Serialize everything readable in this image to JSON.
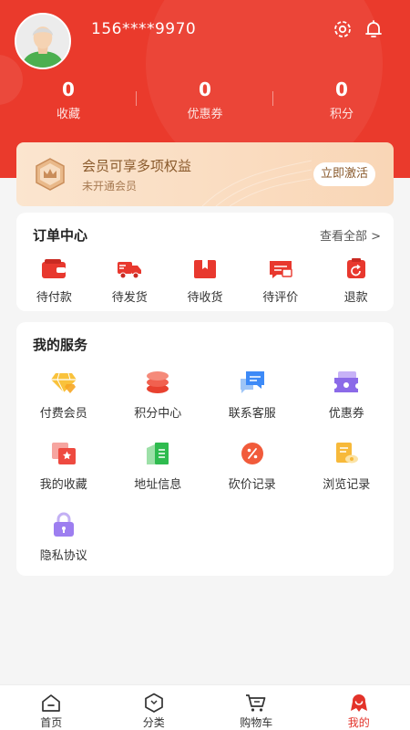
{
  "profile": {
    "phone": "156****9970"
  },
  "header_icons": {
    "settings": "gear-icon",
    "notifications": "bell-icon"
  },
  "stats": [
    {
      "value": "0",
      "label": "收藏"
    },
    {
      "value": "0",
      "label": "优惠券"
    },
    {
      "value": "0",
      "label": "积分"
    }
  ],
  "vip": {
    "title": "会员可享多项权益",
    "subtitle": "未开通会员",
    "action": "立即激活"
  },
  "orders": {
    "title": "订单中心",
    "more": "查看全部 >",
    "items": [
      {
        "label": "待付款",
        "icon": "wallet-icon"
      },
      {
        "label": "待发货",
        "icon": "truck-icon"
      },
      {
        "label": "待收货",
        "icon": "package-icon"
      },
      {
        "label": "待评价",
        "icon": "comment-icon"
      },
      {
        "label": "退款",
        "icon": "refund-icon"
      }
    ]
  },
  "services": {
    "title": "我的服务",
    "items": [
      {
        "label": "付费会员",
        "icon": "diamond-icon"
      },
      {
        "label": "积分中心",
        "icon": "coins-icon"
      },
      {
        "label": "联系客服",
        "icon": "chat-icon"
      },
      {
        "label": "优惠券",
        "icon": "coupon-icon"
      },
      {
        "label": "我的收藏",
        "icon": "favorite-icon"
      },
      {
        "label": "地址信息",
        "icon": "address-icon"
      },
      {
        "label": "砍价记录",
        "icon": "bargain-icon"
      },
      {
        "label": "浏览记录",
        "icon": "history-icon"
      },
      {
        "label": "隐私协议",
        "icon": "lock-icon"
      }
    ]
  },
  "tabbar": [
    {
      "label": "首页",
      "icon": "home-icon"
    },
    {
      "label": "分类",
      "icon": "category-icon"
    },
    {
      "label": "购物车",
      "icon": "cart-icon"
    },
    {
      "label": "我的",
      "icon": "profile-icon",
      "active": true
    }
  ],
  "colors": {
    "brand_red": "#ea3a2c",
    "vip_gold": "#8a5a2c",
    "active_tab": "#e3332a"
  }
}
